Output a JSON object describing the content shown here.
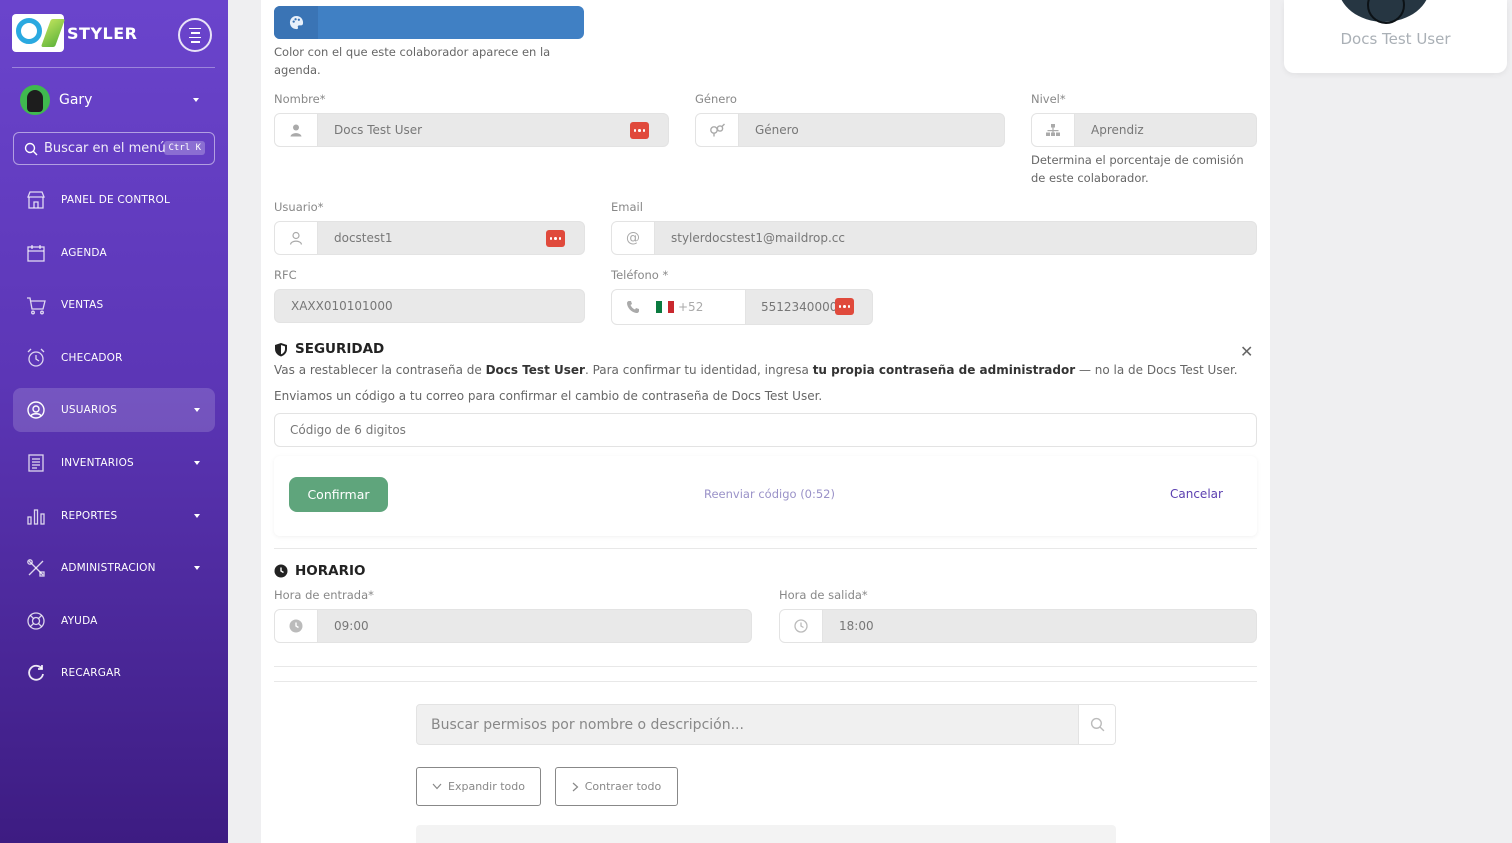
{
  "sidebar": {
    "brand": "STYLER",
    "user_name": "Gary",
    "search_label": "Buscar en el menú",
    "search_shortcut": "Ctrl K",
    "items": [
      {
        "label": "PANEL DE CONTROL",
        "icon": "store-icon"
      },
      {
        "label": "AGENDA",
        "icon": "calendar-icon"
      },
      {
        "label": "VENTAS",
        "icon": "cart-icon"
      },
      {
        "label": "CHECADOR",
        "icon": "alarm-clock-icon"
      },
      {
        "label": "USUARIOS",
        "icon": "user-circle-icon"
      },
      {
        "label": "INVENTARIOS",
        "icon": "list-icon"
      },
      {
        "label": "REPORTES",
        "icon": "bar-chart-icon"
      },
      {
        "label": "ADMINISTRACION",
        "icon": "tools-icon"
      },
      {
        "label": "AYUDA",
        "icon": "lifebuoy-icon"
      },
      {
        "label": "RECARGAR",
        "icon": "reload-icon"
      }
    ]
  },
  "profile_card": {
    "name": "Docs Test User"
  },
  "colors": {
    "agenda_color": "#4080c4",
    "accent": "#5c36b6",
    "confirm": "#5fa57c",
    "danger": "#e04a3c"
  },
  "form": {
    "color_help": "Color con el que este colaborador aparece en la agenda.",
    "nombre_label": "Nombre*",
    "nombre_value": "Docs Test User",
    "genero_label": "Género",
    "genero_placeholder": "Género",
    "nivel_label": "Nivel*",
    "nivel_value": "Aprendiz",
    "nivel_help": "Determina el porcentaje de comisión de este colaborador.",
    "usuario_label": "Usuario*",
    "usuario_value": "docstest1",
    "email_label": "Email",
    "email_value": "stylerdocstest1@maildrop.cc",
    "rfc_label": "RFC",
    "rfc_value": "XAXX010101000",
    "telefono_label": "Teléfono *",
    "telefono_code": "+52",
    "telefono_value": "5512340000"
  },
  "security": {
    "title": "SEGURIDAD",
    "line1_a": "Vas a restablecer la contraseña de ",
    "line1_user": "Docs Test User",
    "line1_b": ". Para confirmar tu identidad, ingresa ",
    "line1_bold": "tu propia contraseña de administrador",
    "line1_c": " — no la de Docs Test User.",
    "line2": "Enviamos un código a tu correo para confirmar el cambio de contraseña de Docs Test User.",
    "code_placeholder": "Código de 6 digitos",
    "confirm_label": "Confirmar",
    "resend_label": "Reenviar código (0:52)",
    "cancel_label": "Cancelar"
  },
  "schedule": {
    "title": "HORARIO",
    "entrada_label": "Hora de entrada*",
    "entrada_value": "09:00",
    "salida_label": "Hora de salida*",
    "salida_value": "18:00"
  },
  "permissions": {
    "search_placeholder": "Buscar permisos por nombre o descripción...",
    "expand_label": "Expandir todo",
    "collapse_label": "Contraer todo"
  }
}
